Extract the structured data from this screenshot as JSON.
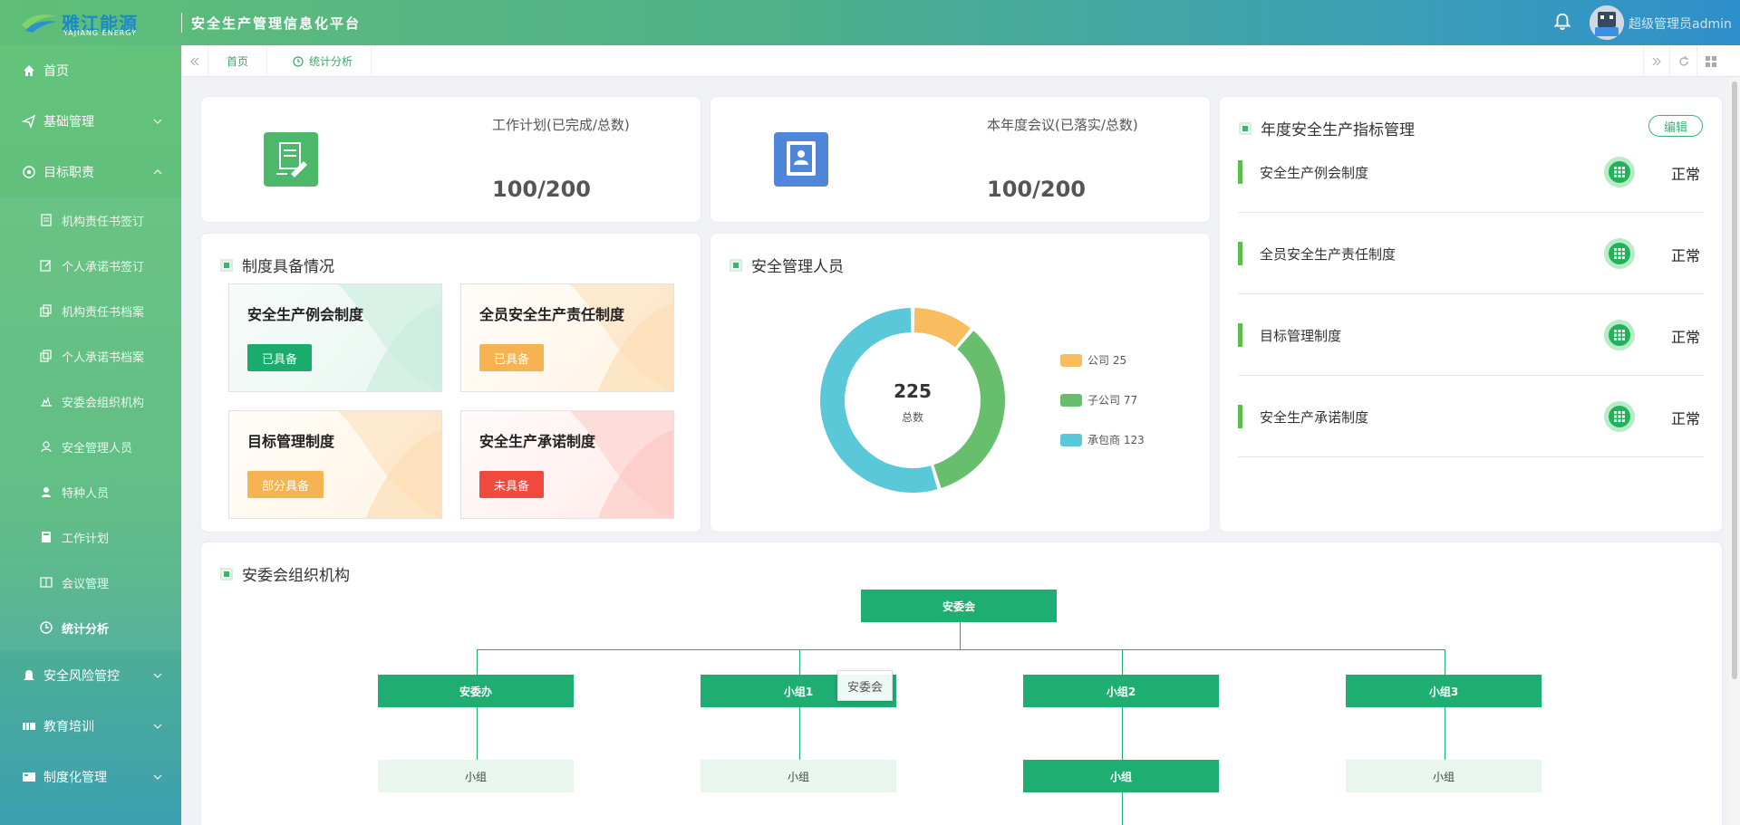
{
  "header": {
    "logo_cn": "雅江能源",
    "logo_en": "YAJIANG ENERGY",
    "title": "安全生产管理信息化平台",
    "user_name": "超级管理员admin"
  },
  "sidebar": {
    "items": [
      {
        "label": "首页",
        "icon": "home-icon"
      },
      {
        "label": "基础管理",
        "icon": "send-icon"
      },
      {
        "label": "目标职责",
        "icon": "target-icon"
      },
      {
        "label": "安全风险管控",
        "icon": "bell-icon"
      },
      {
        "label": "教育培训",
        "icon": "training-icon"
      },
      {
        "label": "制度化管理",
        "icon": "system-icon"
      }
    ],
    "sub_items": [
      {
        "label": "机构责任书签订",
        "icon": "document-icon"
      },
      {
        "label": "个人承诺书签订",
        "icon": "edit-icon"
      },
      {
        "label": "机构责任书档案",
        "icon": "copy-icon"
      },
      {
        "label": "个人承诺书档案",
        "icon": "copy-icon"
      },
      {
        "label": "安委会组织机构",
        "icon": "org-icon"
      },
      {
        "label": "安全管理人员",
        "icon": "user-icon"
      },
      {
        "label": "特种人员",
        "icon": "user-solid-icon"
      },
      {
        "label": "工作计划",
        "icon": "book-icon"
      },
      {
        "label": "会议管理",
        "icon": "meeting-icon"
      },
      {
        "label": "统计分析",
        "icon": "clock-icon"
      }
    ]
  },
  "tabs": [
    {
      "label": "首页"
    },
    {
      "label": "统计分析",
      "icon": "clock-icon"
    }
  ],
  "stats": {
    "work_plan": {
      "label": "工作计划(已完成/总数)",
      "value": "100/200"
    },
    "meetings": {
      "label": "本年度会议(已落实/总数)",
      "value": "100/200"
    }
  },
  "systems": {
    "title": "制度具备情况",
    "items": [
      {
        "name": "安全生产例会制度",
        "status": "已具备",
        "color": "#1aab6d"
      },
      {
        "name": "全员安全生产责任制度",
        "status": "已具备",
        "color": "#f5b352"
      },
      {
        "name": "目标管理制度",
        "status": "部分具备",
        "color": "#f5b352"
      },
      {
        "name": "安全生产承诺制度",
        "status": "未具备",
        "color": "#f04a3e"
      }
    ]
  },
  "personnel": {
    "title": "安全管理人员",
    "total": "225",
    "total_label": "总数"
  },
  "chart_data": {
    "type": "pie",
    "title": "安全管理人员",
    "categories": [
      "公司",
      "子公司",
      "承包商"
    ],
    "values": [
      25,
      77,
      123
    ],
    "colors": [
      "#f7bd5e",
      "#67bf6e",
      "#5ac8d8"
    ],
    "legend_labels": [
      "公司 25",
      "子公司 77",
      "承包商 123"
    ],
    "center_value": "225",
    "center_label": "总数",
    "legend_position": "right"
  },
  "indicators": {
    "title": "年度安全生产指标管理",
    "edit_label": "编辑",
    "items": [
      {
        "name": "安全生产例会制度",
        "status": "正常"
      },
      {
        "name": "全员安全生产责任制度",
        "status": "正常"
      },
      {
        "name": "目标管理制度",
        "status": "正常"
      },
      {
        "name": "安全生产承诺制度",
        "status": "正常"
      }
    ]
  },
  "org": {
    "title": "安委会组织机构",
    "root": "安委会",
    "level1": [
      "安委办",
      "小组1",
      "小组2",
      "小组3"
    ],
    "level2": [
      "小组",
      "小组",
      "小组",
      "小组"
    ],
    "tooltip": "安委会"
  }
}
